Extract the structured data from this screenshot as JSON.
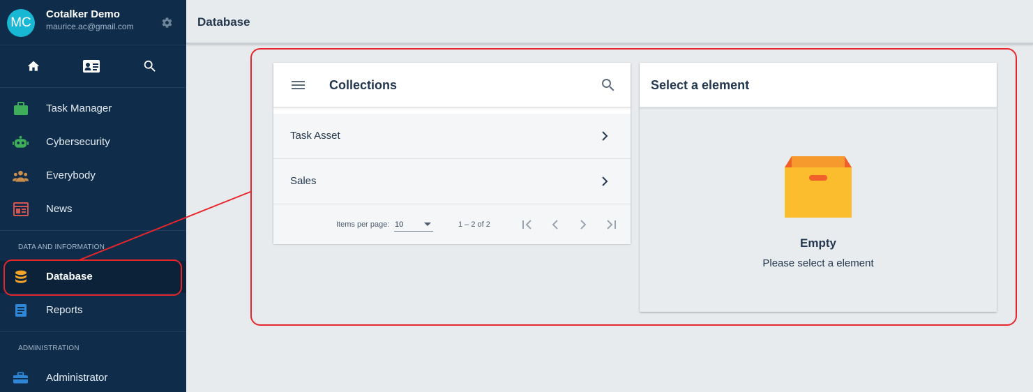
{
  "profile": {
    "initials": "MC",
    "name": "Cotalker Demo",
    "email": "maurice.ac@gmail.com",
    "settings_icon": "gear-icon"
  },
  "quick_actions": [
    {
      "icon": "home-icon"
    },
    {
      "icon": "contact-card-icon"
    },
    {
      "icon": "search-icon"
    }
  ],
  "nav": {
    "items": [
      {
        "label": "Task Manager",
        "icon": "briefcase-icon",
        "color": "#3fae5a"
      },
      {
        "label": "Cybersecurity",
        "icon": "robot-icon",
        "color": "#3fae5a"
      },
      {
        "label": "Everybody",
        "icon": "people-icon",
        "color": "#c98d4c"
      },
      {
        "label": "News",
        "icon": "newspaper-icon",
        "color": "#d9534f"
      }
    ],
    "section_data": "DATA AND INFORMATION",
    "data_items": [
      {
        "label": "Database",
        "icon": "database-icon",
        "color": "#f4a52a",
        "active": true
      },
      {
        "label": "Reports",
        "icon": "report-icon",
        "color": "#2f86d6"
      }
    ],
    "section_admin": "ADMINISTRATION",
    "admin_items": [
      {
        "label": "Administrator",
        "icon": "toolbox-icon",
        "color": "#2f86d6"
      }
    ]
  },
  "header": {
    "title": "Database"
  },
  "collections": {
    "title": "Collections",
    "rows": [
      {
        "label": "Task Asset"
      },
      {
        "label": "Sales"
      }
    ],
    "paginator": {
      "items_per_page_label": "Items per page:",
      "page_size": "10",
      "range": "1 – 2 of 2"
    }
  },
  "detail": {
    "title": "Select a element",
    "empty_title": "Empty",
    "empty_subtitle": "Please select a element",
    "empty_icon": "empty-box-icon"
  },
  "colors": {
    "sidebar": "#0f2d4a",
    "accent_highlight": "#e6262a",
    "box": "#fbbd2e"
  }
}
